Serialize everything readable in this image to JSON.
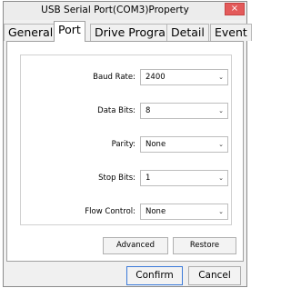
{
  "window": {
    "title": "USB Serial Port(COM3)Property",
    "close_glyph": "×"
  },
  "tabs": [
    {
      "label": "General",
      "active": false
    },
    {
      "label": "Port",
      "active": true
    },
    {
      "label": "Drive Program",
      "active": false
    },
    {
      "label": "Detail",
      "active": false
    },
    {
      "label": "Event",
      "active": false
    }
  ],
  "port_settings": {
    "fields": [
      {
        "label": "Baud Rate:",
        "value": "2400"
      },
      {
        "label": "Data Bits:",
        "value": "8"
      },
      {
        "label": "Parity:",
        "value": "None"
      },
      {
        "label": "Stop Bits:",
        "value": "1"
      },
      {
        "label": "Flow Control:",
        "value": "None"
      }
    ],
    "advanced_label": "Advanced",
    "restore_label": "Restore"
  },
  "footer": {
    "confirm_label": "Confirm",
    "cancel_label": "Cancel"
  },
  "icons": {
    "dropdown": "chevron-down-icon",
    "close": "close-icon"
  }
}
